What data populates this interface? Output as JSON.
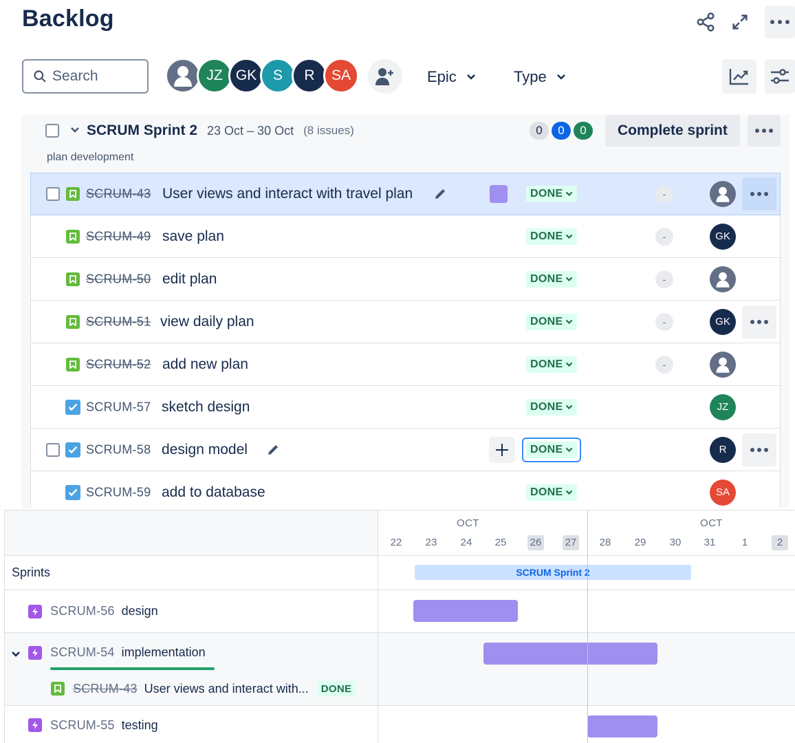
{
  "header": {
    "title": "Backlog"
  },
  "toolbar": {
    "search_placeholder": "Search",
    "avatars": [
      {
        "initials": "",
        "color": "#626f86",
        "kind": "person-icon"
      },
      {
        "initials": "JZ",
        "color": "#1f845a"
      },
      {
        "initials": "GK",
        "color": "#172b4d"
      },
      {
        "initials": "S",
        "color": "#1d9aaa"
      },
      {
        "initials": "R",
        "color": "#172b4d"
      },
      {
        "initials": "SA",
        "color": "#e34935"
      }
    ],
    "epic_filter": "Epic",
    "type_filter": "Type"
  },
  "sprint": {
    "name": "SCRUM Sprint 2",
    "dates": "23 Oct – 30 Oct",
    "count": "(8 issues)",
    "goal": "plan development",
    "todo_count": "0",
    "inprogress_count": "0",
    "done_count": "0",
    "complete_label": "Complete sprint"
  },
  "issues": [
    {
      "key": "SCRUM-43",
      "summary": "User views and interact with travel plan",
      "type": "story",
      "done_key": true,
      "status": "DONE",
      "estimate": "-",
      "assignee": "",
      "assignee_color": "#626f86"
    },
    {
      "key": "SCRUM-49",
      "summary": "save plan",
      "type": "story",
      "done_key": true,
      "status": "DONE",
      "estimate": "-",
      "assignee": "GK",
      "assignee_color": "#172b4d"
    },
    {
      "key": "SCRUM-50",
      "summary": "edit plan",
      "type": "story",
      "done_key": true,
      "status": "DONE",
      "estimate": "-",
      "assignee": "",
      "assignee_color": "#626f86"
    },
    {
      "key": "SCRUM-51",
      "summary": "view daily plan",
      "type": "story",
      "done_key": true,
      "status": "DONE",
      "estimate": "-",
      "assignee": "GK",
      "assignee_color": "#172b4d"
    },
    {
      "key": "SCRUM-52",
      "summary": "add new plan",
      "type": "story",
      "done_key": true,
      "status": "DONE",
      "estimate": "-",
      "assignee": "",
      "assignee_color": "#626f86"
    },
    {
      "key": "SCRUM-57",
      "summary": "sketch design",
      "type": "task",
      "done_key": false,
      "status": "DONE",
      "estimate": "",
      "assignee": "JZ",
      "assignee_color": "#1f845a"
    },
    {
      "key": "SCRUM-58",
      "summary": "design model",
      "type": "task",
      "done_key": false,
      "status": "DONE",
      "estimate": "",
      "assignee": "R",
      "assignee_color": "#172b4d"
    },
    {
      "key": "SCRUM-59",
      "summary": "add to database",
      "type": "task",
      "done_key": false,
      "status": "DONE",
      "estimate": "",
      "assignee": "SA",
      "assignee_color": "#e34935"
    }
  ],
  "timeline": {
    "months": [
      "OCT",
      "OCT"
    ],
    "days": [
      "22",
      "23",
      "24",
      "25",
      "26",
      "27",
      "28",
      "29",
      "30",
      "31",
      "1",
      "2"
    ],
    "sprints_label": "Sprints",
    "sprint_bar_label": "SCRUM Sprint 2",
    "rows": [
      {
        "key": "SCRUM-56",
        "summary": "design"
      },
      {
        "key": "SCRUM-54",
        "summary": "implementation"
      },
      {
        "key": "SCRUM-43",
        "summary": "User views and interact with...",
        "status": "DONE"
      },
      {
        "key": "SCRUM-55",
        "summary": "testing"
      }
    ]
  }
}
